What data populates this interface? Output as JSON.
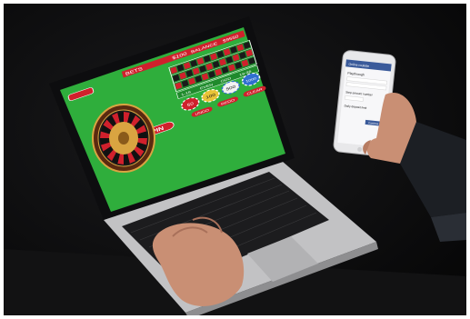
{
  "game": {
    "bet_label": "BETS",
    "bet_value": "$100",
    "balance_label": "BALANCE",
    "balance_value": "$9550",
    "chips": [
      "50",
      "100",
      "500",
      "1000"
    ],
    "buttons": {
      "spin": "SPIN",
      "undo": "UNDO",
      "redo": "REDO",
      "clear": "CLEAR"
    },
    "outside_bets": [
      "1-18",
      "EVEN",
      "ODD",
      "19-36"
    ]
  },
  "phone": {
    "header": "Online roulette",
    "section1": "Playthrough",
    "section2": "Step amount number",
    "section3": "Daily deposit limit",
    "button": "Continue"
  },
  "colors": {
    "felt": "#2fae3c",
    "felt_dark": "#1f8a2c",
    "bet_red": "#d0202c",
    "laptop_body": "#c9c9cb",
    "keyboard": "#1c1c1e",
    "phone_header": "#3a5a9a"
  }
}
